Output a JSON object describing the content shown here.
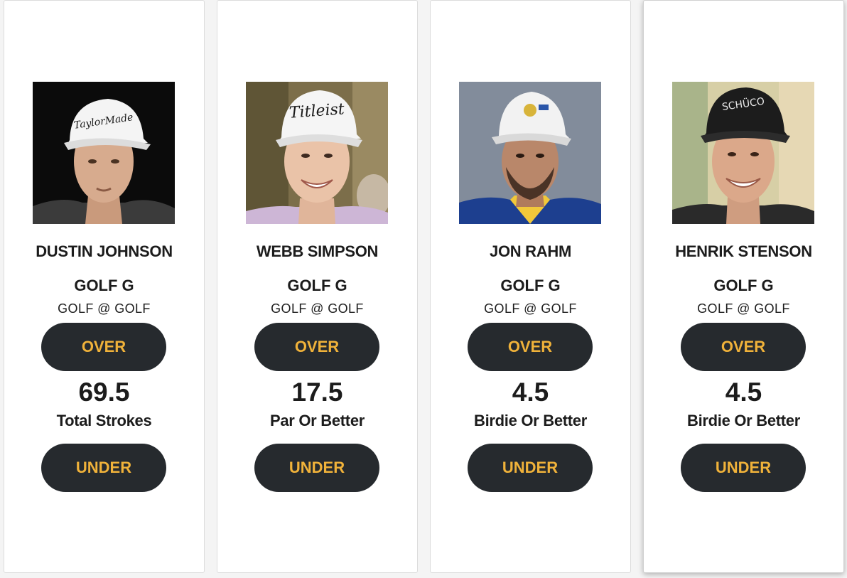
{
  "colors": {
    "button_bg": "#262a2e",
    "button_text": "#f0b23a",
    "card_bg": "#ffffff",
    "page_bg": "#f4f4f4"
  },
  "cards": [
    {
      "player_name": "DUSTIN JOHNSON",
      "sport_label": "GOLF G",
      "matchup": "GOLF @ GOLF",
      "over_label": "OVER",
      "line_value": "69.5",
      "stat_type": "Total Strokes",
      "under_label": "UNDER",
      "photo_icon": "player-headshot",
      "cap_logo": "TaylorMade"
    },
    {
      "player_name": "WEBB SIMPSON",
      "sport_label": "GOLF G",
      "matchup": "GOLF @ GOLF",
      "over_label": "OVER",
      "line_value": "17.5",
      "stat_type": "Par Or Better",
      "under_label": "UNDER",
      "photo_icon": "player-headshot",
      "cap_logo": "Titleist"
    },
    {
      "player_name": "JON RAHM",
      "sport_label": "GOLF G",
      "matchup": "GOLF @ GOLF",
      "over_label": "OVER",
      "line_value": "4.5",
      "stat_type": "Birdie Or Better",
      "under_label": "UNDER",
      "photo_icon": "player-headshot"
    },
    {
      "player_name": "HENRIK STENSON",
      "sport_label": "GOLF G",
      "matchup": "GOLF @ GOLF",
      "over_label": "OVER",
      "line_value": "4.5",
      "stat_type": "Birdie Or Better",
      "under_label": "UNDER",
      "photo_icon": "player-headshot",
      "cap_logo": "SCHÜCO"
    }
  ]
}
